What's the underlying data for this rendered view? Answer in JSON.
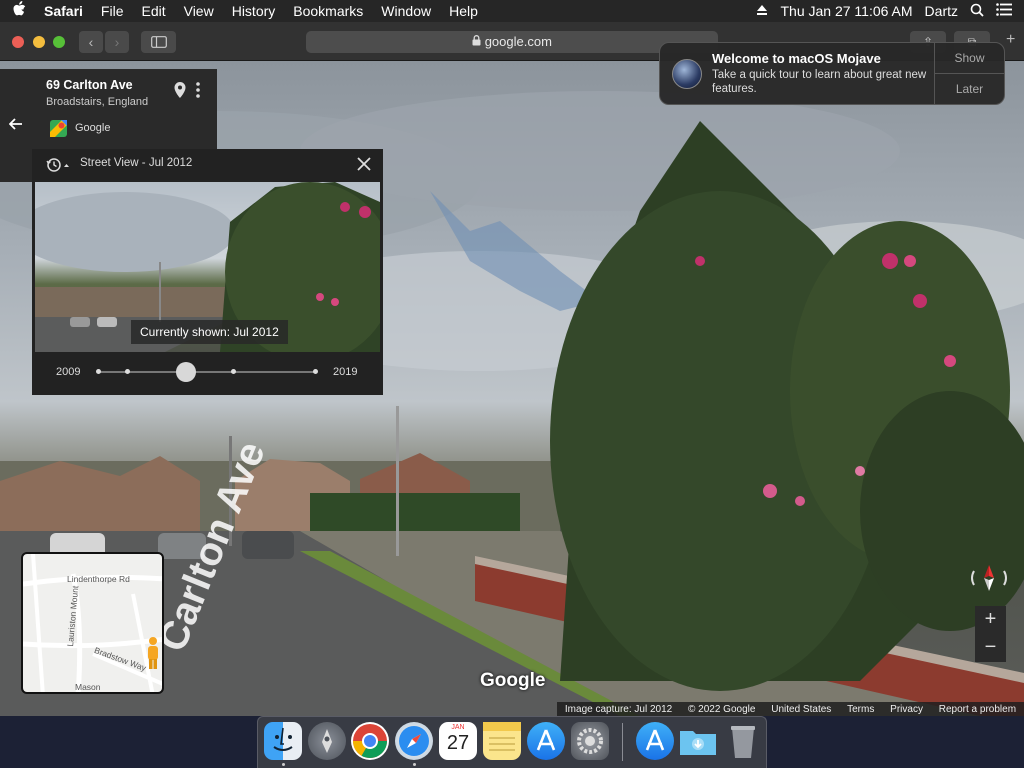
{
  "menubar": {
    "apple": "",
    "app_name": "Safari",
    "items": [
      "File",
      "Edit",
      "View",
      "History",
      "Bookmarks",
      "Window",
      "Help"
    ],
    "datetime": "Thu Jan 27  11:06 AM",
    "user": "Dartz"
  },
  "toolbar": {
    "back": "‹",
    "forward": "›",
    "address": "google.com"
  },
  "notification": {
    "title": "Welcome to macOS Mojave",
    "body": "Take a quick tour to learn about great new features.",
    "show_label": "Show",
    "later_label": "Later"
  },
  "place": {
    "address": "69 Carlton Ave",
    "locality": "Broadstairs, England",
    "source": "Google"
  },
  "street_view": {
    "title": "Street View - Jul 2012",
    "currently_shown": "Currently shown: Jul 2012",
    "year_start": "2009",
    "year_end": "2019",
    "slider_position": 0.41
  },
  "minimap": {
    "labels": [
      "Lindenthorpe Rd",
      "Lauriston Mount",
      "Bradstow Way",
      "Mason"
    ]
  },
  "road_label": "Carlton Ave",
  "google_logo": "Google",
  "footer": {
    "capture": "Image capture: Jul 2012",
    "copyright": "© 2022 Google",
    "region": "United States",
    "terms": "Terms",
    "privacy": "Privacy",
    "report": "Report a problem"
  },
  "zoom": {
    "plus": "+",
    "minus": "−"
  },
  "dock": {
    "apps": [
      "finder-icon",
      "launchpad-icon",
      "chrome-icon",
      "safari-icon",
      "calendar-icon",
      "notes-icon",
      "app-store-icon",
      "system-preferences-icon",
      "app-store-download-icon",
      "downloads-folder-icon",
      "trash-icon"
    ],
    "calendar_month": "JAN",
    "calendar_day": "27"
  },
  "colors": {
    "menubar": "#262626",
    "panel": "#2a2a2a",
    "accent_red": "#ec5f56",
    "accent_yellow": "#f4bd3e",
    "accent_green": "#57c038"
  }
}
